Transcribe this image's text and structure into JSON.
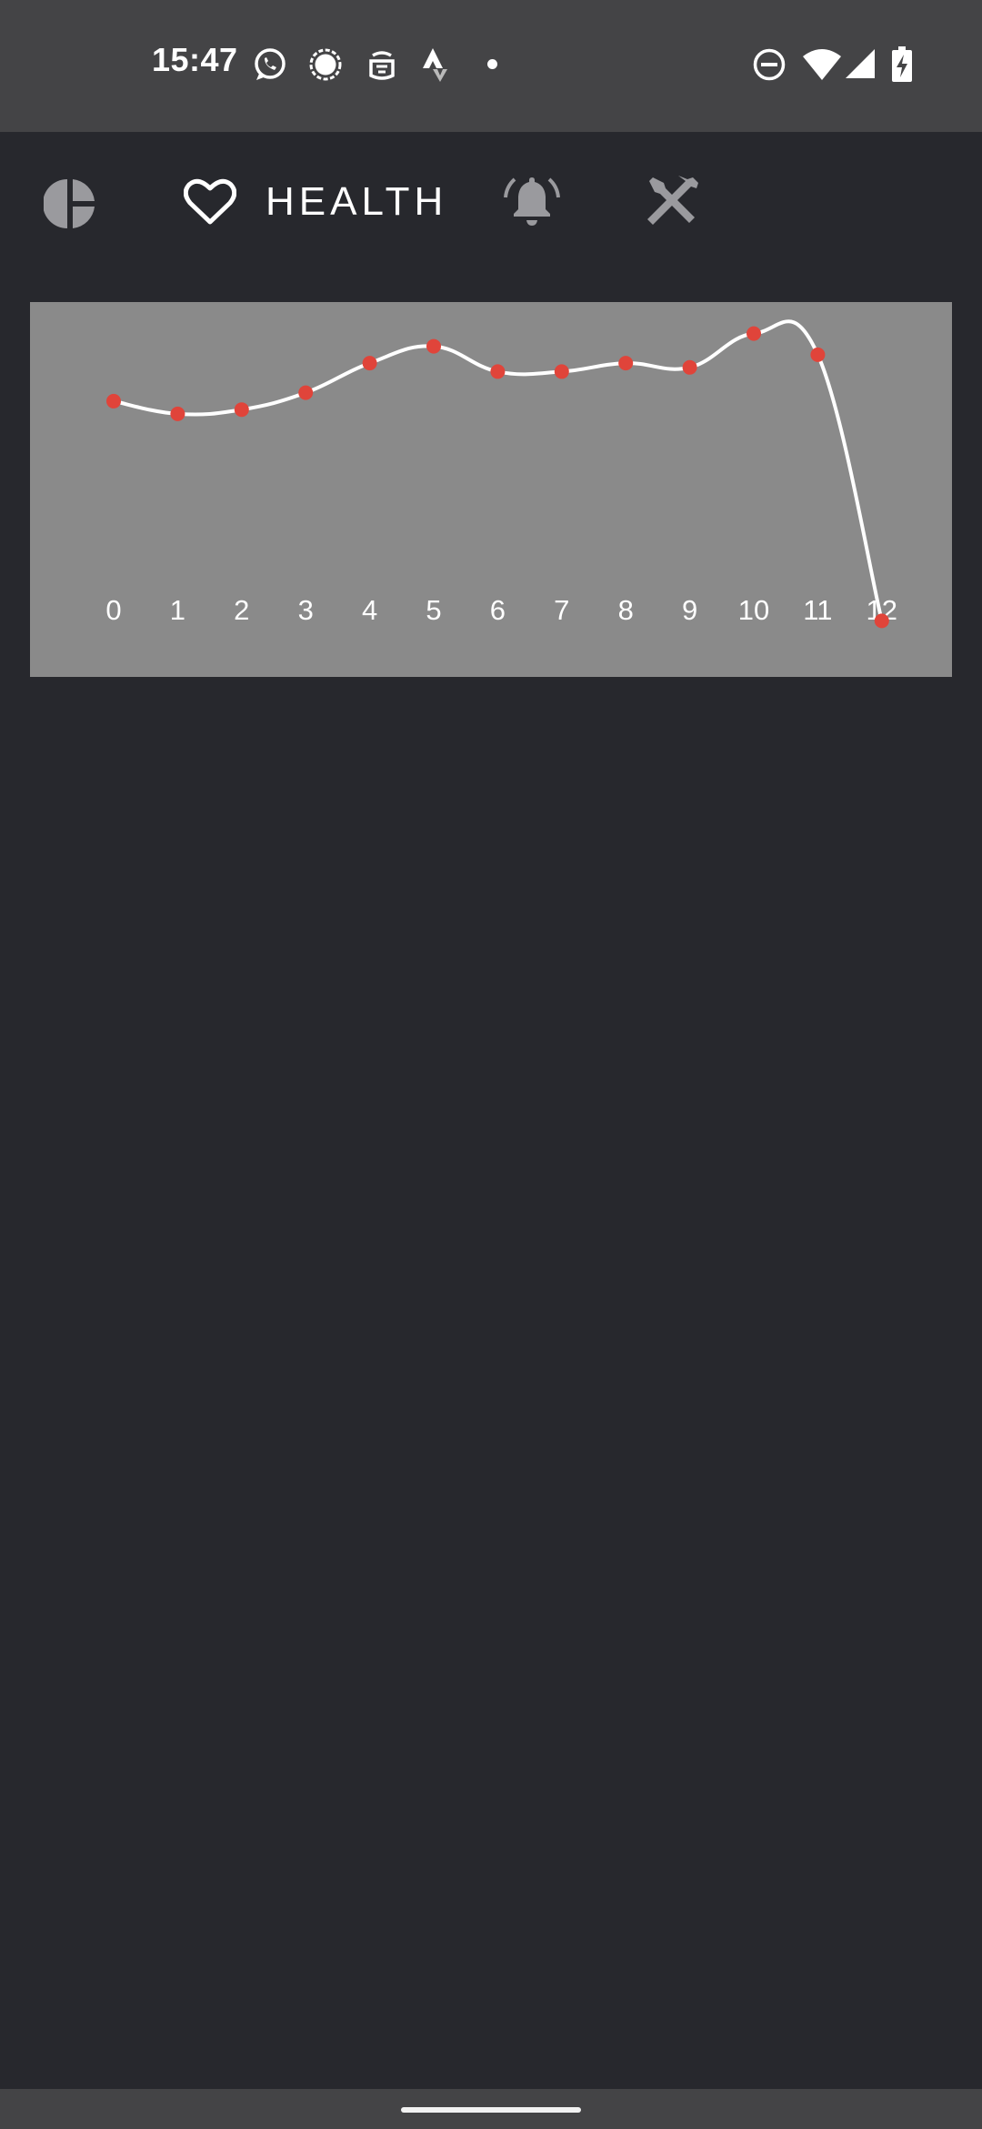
{
  "status_bar": {
    "time": "15:47",
    "left_icons": [
      "whatsapp-icon",
      "signal-icon",
      "notification-app-icon",
      "strava-icon",
      "more-dot-icon"
    ],
    "right_icons": [
      "do-not-disturb-icon",
      "wifi-icon",
      "cell-signal-icon",
      "battery-charging-icon"
    ]
  },
  "tabs": [
    {
      "id": "stats",
      "icon": "pie-chart-icon",
      "label": "",
      "active": false
    },
    {
      "id": "health",
      "icon": "heart-icon",
      "label": "HEALTH",
      "active": true
    },
    {
      "id": "alarms",
      "icon": "alarm-bell-icon",
      "label": "",
      "active": false
    },
    {
      "id": "tools",
      "icon": "tools-icon",
      "label": "",
      "active": false
    }
  ],
  "colors": {
    "background": "#27282d",
    "status_bar": "#444446",
    "chart_background": "#8a8a8a",
    "line": "#ffffff",
    "point": "#e0443a",
    "inactive_icon": "#9a9a9e"
  },
  "chart_data": {
    "type": "line",
    "title": "",
    "xlabel": "",
    "ylabel": "",
    "x": [
      0,
      1,
      2,
      3,
      4,
      5,
      6,
      7,
      8,
      9,
      10,
      11,
      12
    ],
    "values": [
      68,
      65,
      66,
      70,
      77,
      81,
      75,
      75,
      77,
      76,
      84,
      79,
      16
    ],
    "ylim": [
      15,
      85
    ],
    "grid": false,
    "smooth": true
  }
}
